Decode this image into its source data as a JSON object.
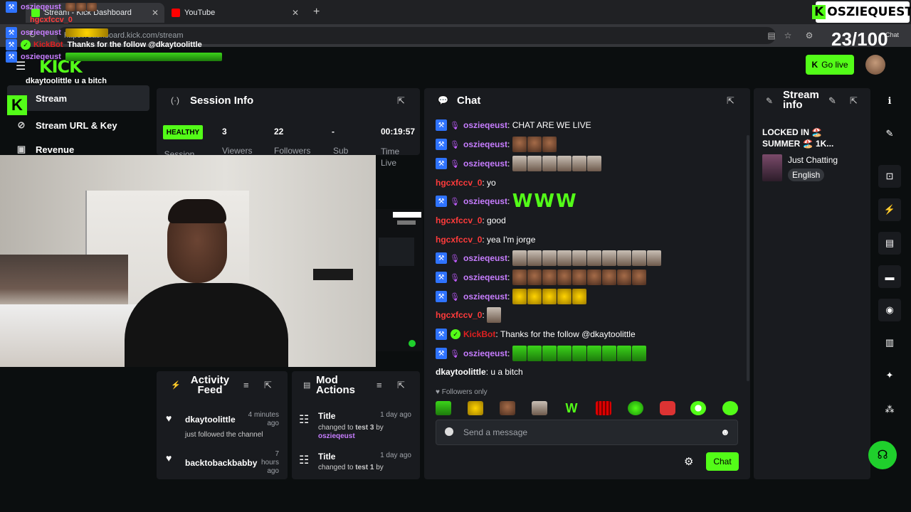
{
  "browser": {
    "tabs": [
      {
        "title": "Stream - Kick Dashboard",
        "active": true
      },
      {
        "title": "YouTube",
        "active": false
      }
    ],
    "url": "https://dashboard.kick.com/stream",
    "profile_label": "Chat"
  },
  "overlay": {
    "chat": [
      {
        "user": "oszieqeust",
        "text": ""
      },
      {
        "user": "hgcxfccv_0",
        "text": ""
      },
      {
        "user": "oszieqeust",
        "text": ""
      },
      {
        "user": "KickBot",
        "text": "Thanks for the follow @dkaytoolittle"
      },
      {
        "user": "oszieqeust",
        "text": ""
      },
      {
        "user": "dkaytoolittle",
        "text": "u a bitch"
      }
    ],
    "brand": "OSZIEQUEST",
    "counter": "23/100"
  },
  "header": {
    "logo": "KICK",
    "go_live": "Go live",
    "accent": "#53fc18"
  },
  "sidebar": {
    "items": [
      {
        "label": "Stream",
        "icon": "stream-icon"
      },
      {
        "label": "Stream URL & Key",
        "icon": "key-icon"
      },
      {
        "label": "Revenue",
        "icon": "revenue-icon"
      }
    ]
  },
  "session_info": {
    "title": "Session Info",
    "status": "HEALTHY",
    "status_label": "Session",
    "viewers": {
      "value": "3",
      "label": "Viewers"
    },
    "followers": {
      "value": "22",
      "label": "Followers"
    },
    "subs": {
      "value": "-",
      "label": "Sub"
    },
    "time": {
      "value": "00:19:57",
      "label": "Time Live"
    }
  },
  "chat": {
    "title": "Chat",
    "messages": [
      {
        "user": "oszieqeust",
        "text": "CHAT ARE WE LIVE",
        "badges": "mod",
        "color": "purple"
      },
      {
        "user": "oszieqeust",
        "text": "",
        "emotes": 3,
        "kind": "face",
        "badges": "mod",
        "color": "purple"
      },
      {
        "user": "oszieqeust",
        "text": "",
        "emotes": 6,
        "kind": "room",
        "badges": "mod",
        "color": "purple"
      },
      {
        "user": "hgcxfccv_0",
        "text": "yo",
        "color": "red"
      },
      {
        "user": "oszieqeust",
        "text": "WWW",
        "badges": "mod",
        "color": "purple"
      },
      {
        "user": "hgcxfccv_0",
        "text": "good",
        "color": "red"
      },
      {
        "user": "hgcxfccv_0",
        "text": "yea I'm jorge",
        "color": "red"
      },
      {
        "user": "oszieqeust",
        "text": "",
        "emotes": 10,
        "kind": "room",
        "badges": "mod",
        "color": "purple"
      },
      {
        "user": "oszieqeust",
        "text": "",
        "emotes": 9,
        "kind": "face",
        "badges": "mod",
        "color": "purple"
      },
      {
        "user": "oszieqeust",
        "text": "",
        "emotes": 5,
        "kind": "yellow",
        "badges": "mod",
        "color": "purple"
      },
      {
        "user": "hgcxfccv_0",
        "text": "",
        "emotes": 1,
        "kind": "room",
        "color": "red"
      },
      {
        "user": "KickBot",
        "text": "Thanks for the follow @dkaytoolittle",
        "badges": "bot",
        "color": "red"
      },
      {
        "user": "oszieqeust",
        "text": "",
        "emotes": 9,
        "kind": "green",
        "badges": "mod",
        "color": "purple"
      },
      {
        "user": "dkaytoolittle",
        "text": "u a bitch",
        "color": "white"
      }
    ],
    "followers_only": "Followers only",
    "input_placeholder": "Send a message",
    "send_label": "Chat"
  },
  "stream_info": {
    "title": "Stream info",
    "stream_title": "LOCKED IN 🏖️ SUMMER 🏖️ 1K...",
    "category": "Just Chatting",
    "language": "English"
  },
  "activity_feed": {
    "title": "Activity Feed",
    "items": [
      {
        "name": "dkaytoolittle",
        "desc": "just followed the channel",
        "time": "4 minutes ago"
      },
      {
        "name": "backtobackbabby",
        "desc": "",
        "time": "7 hours ago"
      }
    ]
  },
  "mod_actions": {
    "title": "Mod Actions",
    "items": [
      {
        "title": "Title",
        "desc": "changed to",
        "value": "test 3",
        "by": "by",
        "user": "oszieqeust",
        "time": "1 day ago"
      },
      {
        "title": "Title",
        "desc": "changed to",
        "value": "test 1",
        "by": "by",
        "user": "",
        "time": "1 day ago"
      }
    ]
  }
}
